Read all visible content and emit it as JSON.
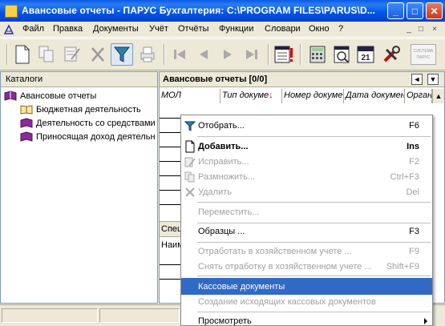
{
  "window": {
    "title": "Авансовые отчеты - ПАРУС Бухгалтерия: C:\\PROGRAM FILES\\PARUS\\D...",
    "controls": {
      "minimize": "_",
      "maximize": "□",
      "close": "✕"
    }
  },
  "menubar": {
    "items": [
      "Файл",
      "Правка",
      "Документы",
      "Учёт",
      "Отчёты",
      "Функции",
      "Словари",
      "Окно",
      "?"
    ],
    "mdi": [
      "_",
      "□",
      "×"
    ]
  },
  "toolbar": {
    "buttons": [
      "new-document",
      "copy",
      "edit",
      "delete",
      "filter",
      "print",
      "first",
      "prev",
      "next",
      "last",
      "calendar",
      "calculator",
      "preview",
      "date-21",
      "tools",
      "parus-system"
    ],
    "date_badge": "21",
    "system_label": "СИСТЕМА ПАРУС"
  },
  "left_panel": {
    "header": "Каталоги",
    "tree": [
      {
        "label": "Авансовые отчеты",
        "level": 0
      },
      {
        "label": "Бюджетная деятельность",
        "level": 1
      },
      {
        "label": "Деятельность со средствами",
        "level": 1
      },
      {
        "label": "Приносящая доход деятельн",
        "level": 1
      }
    ]
  },
  "right_panel": {
    "header": "Авансовые отчеты [0/0]",
    "columns": [
      "МОЛ",
      "Тип докуме",
      "Номер докуме",
      "Дата докумен",
      "Органи"
    ],
    "lower_header": "Спец",
    "lower_column": "Наим"
  },
  "context_menu": {
    "items": [
      {
        "label": "Отобрать...",
        "shortcut": "F6",
        "icon": "filter-icon",
        "disabled": false,
        "bold": false
      },
      {
        "separator": true
      },
      {
        "label": "Добавить...",
        "shortcut": "Ins",
        "icon": "new-doc-icon",
        "disabled": false,
        "bold": true
      },
      {
        "label": "Исправить...",
        "shortcut": "F2",
        "icon": "edit-icon",
        "disabled": true,
        "bold": false
      },
      {
        "label": "Размножить...",
        "shortcut": "Ctrl+F3",
        "icon": "copy-icon",
        "disabled": true,
        "bold": false
      },
      {
        "label": "Удалить",
        "shortcut": "Del",
        "icon": "delete-icon",
        "disabled": true,
        "bold": false
      },
      {
        "separator": true
      },
      {
        "label": "Переместить...",
        "shortcut": "",
        "disabled": true,
        "bold": false
      },
      {
        "separator": true
      },
      {
        "label": "Образцы ...",
        "shortcut": "F3",
        "disabled": false,
        "bold": false
      },
      {
        "separator": true
      },
      {
        "label": "Отработать в хозяйственном учете ...",
        "shortcut": "F9",
        "disabled": true,
        "bold": false
      },
      {
        "label": "Снять отработку в хозяйственном учете ...",
        "shortcut": "Shift+F9",
        "disabled": true,
        "bold": false
      },
      {
        "separator": true
      },
      {
        "label": "Кассовые документы",
        "shortcut": "",
        "disabled": false,
        "bold": false,
        "highlighted": true
      },
      {
        "label": "Создание исходящих кассовых документов",
        "shortcut": "",
        "disabled": true,
        "bold": false
      },
      {
        "separator": true
      },
      {
        "label": "Просмотреть",
        "shortcut": "",
        "disabled": false,
        "bold": false,
        "submenu": true
      }
    ]
  },
  "colors": {
    "title_bar": "#0055e5",
    "highlight": "#316ac5",
    "disabled_text": "#a0a0a0",
    "chrome": "#ece9d8"
  }
}
